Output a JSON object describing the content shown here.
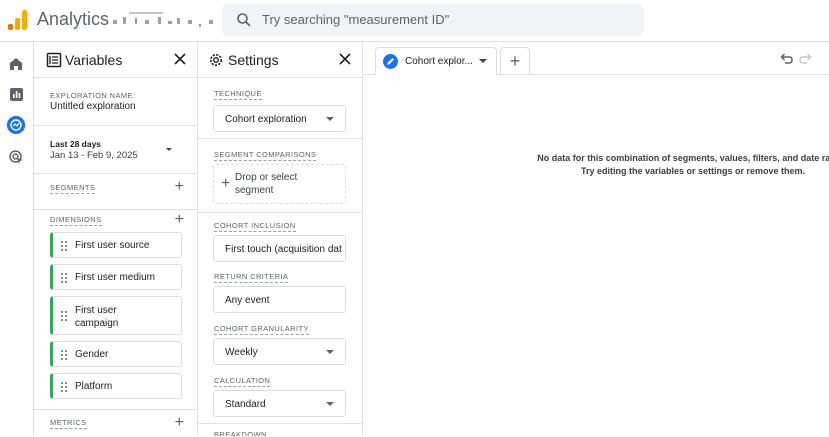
{
  "app": {
    "title": "Analytics"
  },
  "search": {
    "placeholder": "Try searching \"measurement ID\""
  },
  "variables": {
    "title": "Variables",
    "exploration_name_label": "EXPLORATION NAME:",
    "exploration_name": "Untitled exploration",
    "date_range_label": "Last 28 days",
    "date_range": "Jan 13 - Feb 9, 2025",
    "segments_label": "SEGMENTS",
    "dimensions_label": "DIMENSIONS",
    "dimensions": [
      "First user source",
      "First user medium",
      "First user campaign",
      "Gender",
      "Platform"
    ],
    "metrics_label": "METRICS"
  },
  "settings": {
    "title": "Settings",
    "technique_label": "TECHNIQUE",
    "technique": "Cohort exploration",
    "segment_comparisons_label": "SEGMENT COMPARISONS",
    "drop_segment": "Drop or select segment",
    "cohort_inclusion_label": "COHORT INCLUSION",
    "cohort_inclusion": "First touch (acquisition dat",
    "return_criteria_label": "RETURN CRITERIA",
    "return_criteria": "Any event",
    "cohort_granularity_label": "COHORT GRANULARITY",
    "cohort_granularity": "Weekly",
    "calculation_label": "CALCULATION",
    "calculation": "Standard",
    "breakdown_label": "BREAKDOWN"
  },
  "canvas": {
    "tab_label": "Cohort explor...",
    "add_tab": "+",
    "nodata_line1": "No data for this combination of segments, values, filters, and date range.",
    "nodata_line2": "Try editing the variables or settings or remove them."
  },
  "icons": [
    "analytics-logo",
    "search-icon",
    "home-icon",
    "reports-icon",
    "explore-icon",
    "advertising-icon",
    "variables-icon",
    "close-icon",
    "settings-gear-icon",
    "pencil-icon",
    "undo-icon",
    "redo-icon"
  ],
  "colors": {
    "accent": "#1a73e8",
    "chip_border": "#34a853",
    "logo_orange": "#f9ab00",
    "logo_dark": "#e37400"
  }
}
